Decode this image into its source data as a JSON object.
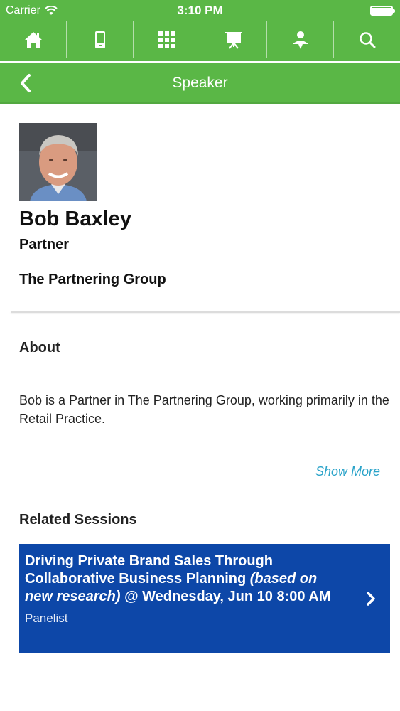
{
  "status_bar": {
    "carrier": "Carrier",
    "time": "3:10 PM",
    "battery_level": 1.0
  },
  "nav_icons": [
    "home-icon",
    "mobile-device-icon",
    "qr-code-icon",
    "presentation-easel-icon",
    "speaker-person-icon",
    "search-icon"
  ],
  "header": {
    "title": "Speaker"
  },
  "speaker": {
    "name": "Bob Baxley",
    "title": "Partner",
    "company": "The Partnering Group"
  },
  "about": {
    "heading": "About",
    "text": "Bob is a Partner in The Partnering Group, working primarily in the Retail Practice.",
    "show_more": "Show More"
  },
  "related": {
    "heading": "Related Sessions",
    "sessions": [
      {
        "title_main": "Driving Private Brand Sales Through Collaborative Business Planning ",
        "title_italic": "(based on new research)",
        "title_tail": " @ Wednesday, Jun 10 8:00 AM",
        "role": "Panelist"
      }
    ]
  },
  "colors": {
    "brand_green": "#5ab746",
    "session_blue": "#0d47a8",
    "link_cyan": "#2aa3c9"
  }
}
